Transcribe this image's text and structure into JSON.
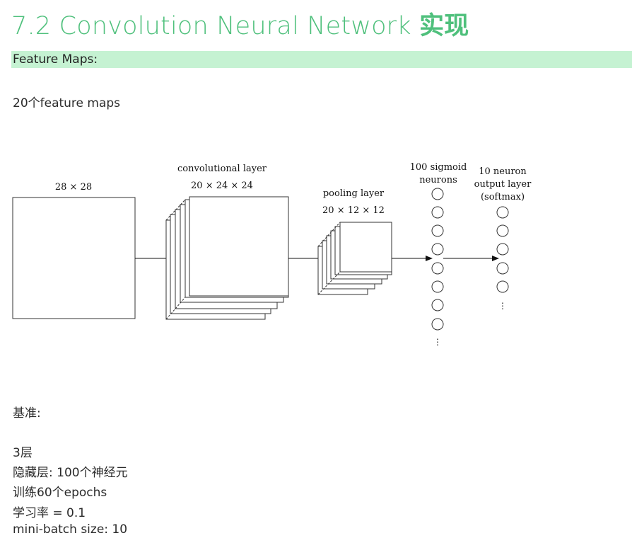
{
  "header": {
    "title": "7.2 Convolution Neural Network",
    "title_cn": "实现"
  },
  "section": {
    "label": "Feature Maps:"
  },
  "intro": "20个feature maps",
  "diagram": {
    "input_size": "28 × 28",
    "conv_label": "convolutional layer",
    "conv_size": "20 × 24 × 24",
    "pool_label": "pooling layer",
    "pool_size": "20 × 12 × 12",
    "hidden_label_1": "100 sigmoid",
    "hidden_label_2": "neurons",
    "output_label_1": "10 neuron",
    "output_label_2": "output layer",
    "output_label_3": "(softmax)",
    "ellipsis": "⋮"
  },
  "baseline": {
    "heading": "基准:",
    "lines": [
      "3层",
      "隐藏层: 100个神经元",
      "训练60个epochs",
      "学习率 = 0.1",
      "mini-batch size: 10"
    ]
  }
}
